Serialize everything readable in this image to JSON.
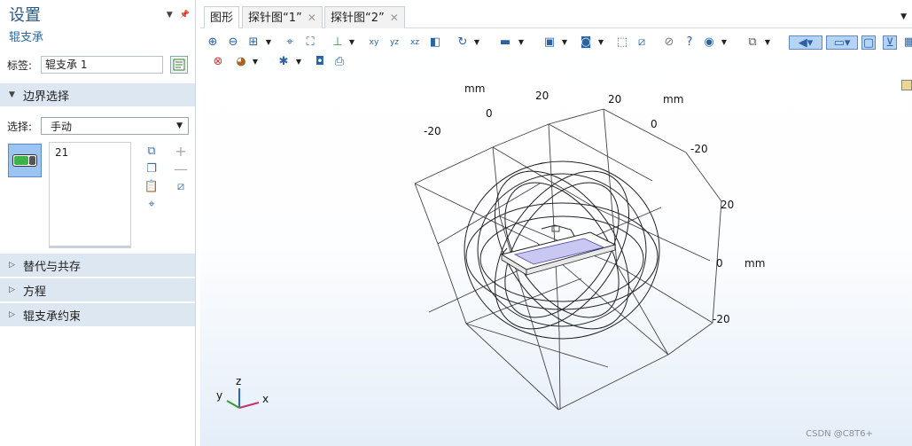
{
  "settings": {
    "title": "设置",
    "subtitle": "辊支承",
    "label_caption": "标签:",
    "label_value": "辊支承 1",
    "sections": {
      "boundary": "边界选择",
      "override": "替代与共存",
      "equation": "方程",
      "constraint": "辊支承约束"
    },
    "selection_caption": "选择:",
    "selection_value": "手动",
    "selection_items": [
      "21"
    ]
  },
  "tabs": [
    {
      "label": "图形"
    },
    {
      "label": "探针图“1”"
    },
    {
      "label": "探针图“2”"
    }
  ],
  "axes": {
    "unit": "mm",
    "ticks_back_left": [
      "-20",
      "0",
      "20"
    ],
    "ticks_back_right": [
      "20",
      "0",
      "-20"
    ],
    "ticks_front_right": [
      "20",
      "0",
      "-20"
    ],
    "triad": {
      "x": "x",
      "y": "y",
      "z": "z"
    }
  },
  "colors": {
    "accent": "#2a62a8",
    "section_bg": "#dde7f1",
    "selected_face": "#c8c8f2"
  },
  "watermark": "CSDN @C8T6+"
}
